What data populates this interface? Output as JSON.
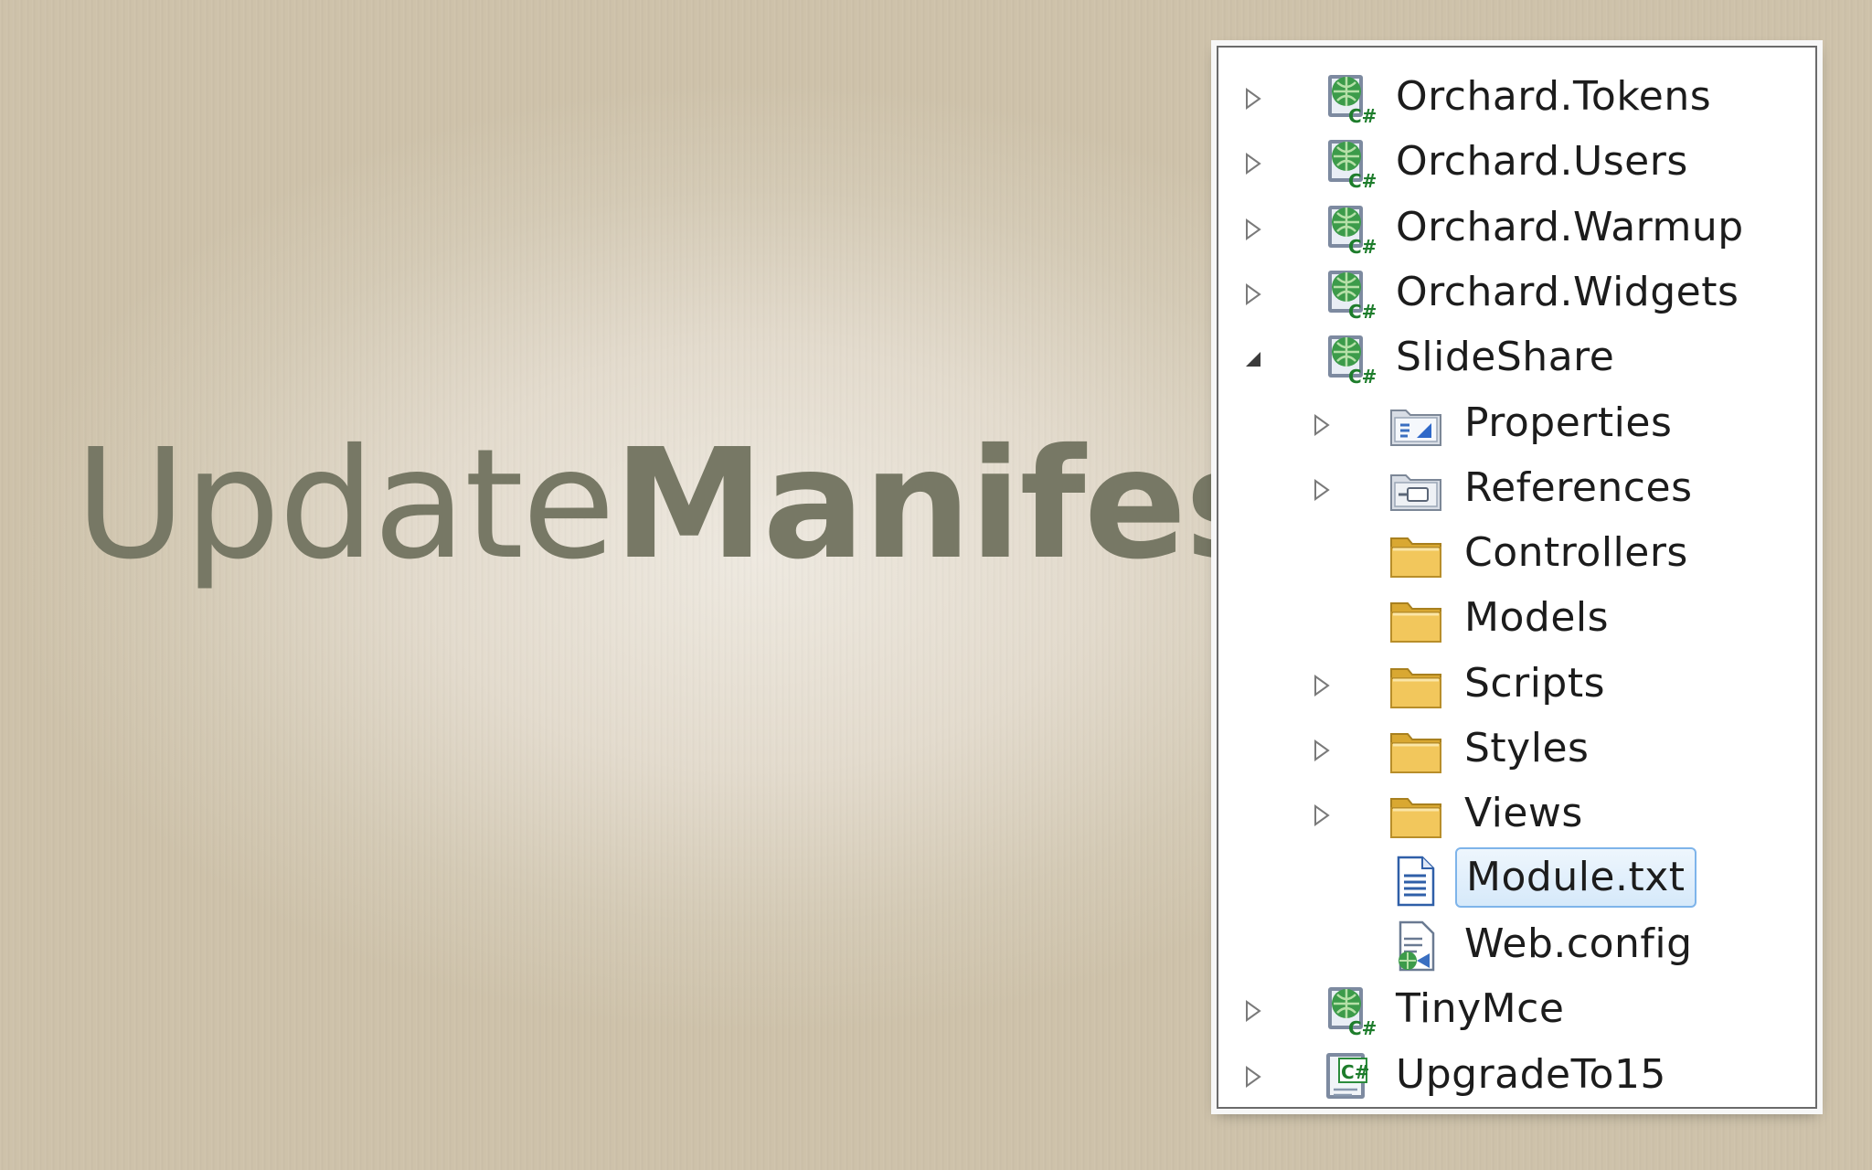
{
  "slide": {
    "title_light": "Update",
    "title_bold": "Manifest"
  },
  "solution_tree": {
    "items": [
      {
        "label": "Orchard.Tokens",
        "icon": "csharp-web-project-icon",
        "level": 0,
        "expander": "collapsed"
      },
      {
        "label": "Orchard.Users",
        "icon": "csharp-web-project-icon",
        "level": 0,
        "expander": "collapsed"
      },
      {
        "label": "Orchard.Warmup",
        "icon": "csharp-web-project-icon",
        "level": 0,
        "expander": "collapsed"
      },
      {
        "label": "Orchard.Widgets",
        "icon": "csharp-web-project-icon",
        "level": 0,
        "expander": "collapsed"
      },
      {
        "label": "SlideShare",
        "icon": "csharp-web-project-icon",
        "level": 0,
        "expander": "expanded"
      },
      {
        "label": "Properties",
        "icon": "properties-folder-icon",
        "level": 1,
        "expander": "collapsed"
      },
      {
        "label": "References",
        "icon": "references-folder-icon",
        "level": 1,
        "expander": "collapsed"
      },
      {
        "label": "Controllers",
        "icon": "folder-icon",
        "level": 1,
        "expander": "none"
      },
      {
        "label": "Models",
        "icon": "folder-icon",
        "level": 1,
        "expander": "none"
      },
      {
        "label": "Scripts",
        "icon": "folder-icon",
        "level": 1,
        "expander": "collapsed"
      },
      {
        "label": "Styles",
        "icon": "folder-icon",
        "level": 1,
        "expander": "collapsed"
      },
      {
        "label": "Views",
        "icon": "folder-icon",
        "level": 1,
        "expander": "collapsed"
      },
      {
        "label": "Module.txt",
        "icon": "text-file-icon",
        "level": 1,
        "expander": "none",
        "selected": true
      },
      {
        "label": "Web.config",
        "icon": "config-file-icon",
        "level": 1,
        "expander": "none"
      },
      {
        "label": "TinyMce",
        "icon": "csharp-web-project-icon",
        "level": 0,
        "expander": "collapsed"
      },
      {
        "label": "UpgradeTo15",
        "icon": "csharp-project-icon",
        "level": 0,
        "expander": "collapsed"
      }
    ]
  },
  "colors": {
    "title": "#777865",
    "selection_border": "#7eb4ea",
    "folder": "#f2c75c"
  }
}
